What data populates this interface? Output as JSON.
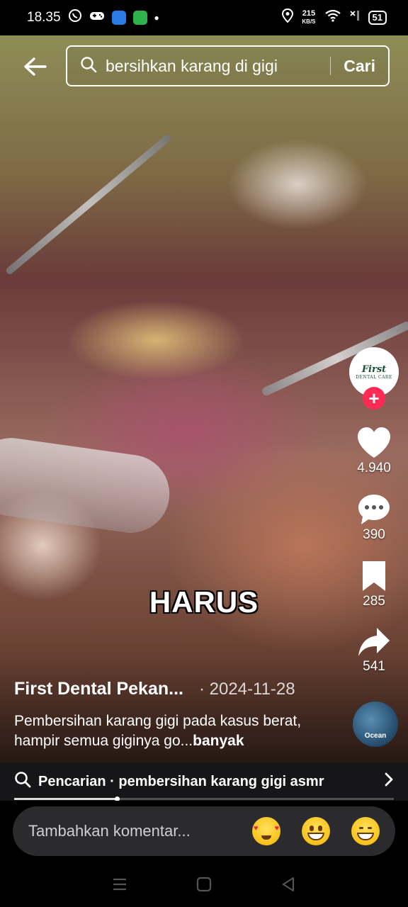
{
  "status_bar": {
    "time": "18.35",
    "net_speed_value": "215",
    "net_speed_unit": "KB/S",
    "battery": "51"
  },
  "search": {
    "query": "bersihkan karang di gigi",
    "submit_label": "Cari"
  },
  "video": {
    "overlay_text": "HARUS"
  },
  "actions": {
    "avatar_line1": "First",
    "avatar_line2": "DENTAL CARE",
    "follow_symbol": "+",
    "likes": "4.940",
    "comments": "390",
    "bookmarks": "285",
    "shares": "541",
    "sound_label": "Ocean"
  },
  "post": {
    "author": "First Dental Pekan...",
    "date": "· 2024-11-28",
    "description": "Pembersihan karang gigi pada kasus berat, hampir semua giginya go...",
    "more_label": "banyak"
  },
  "related_search": {
    "text": "Pencarian · pembersihan karang gigi asmr"
  },
  "playback": {
    "progress": 0.27
  },
  "comment": {
    "placeholder": "Tambahkan komentar..."
  },
  "colors": {
    "accent": "#fe2c55",
    "comment_bg": "#2b2b2d"
  }
}
